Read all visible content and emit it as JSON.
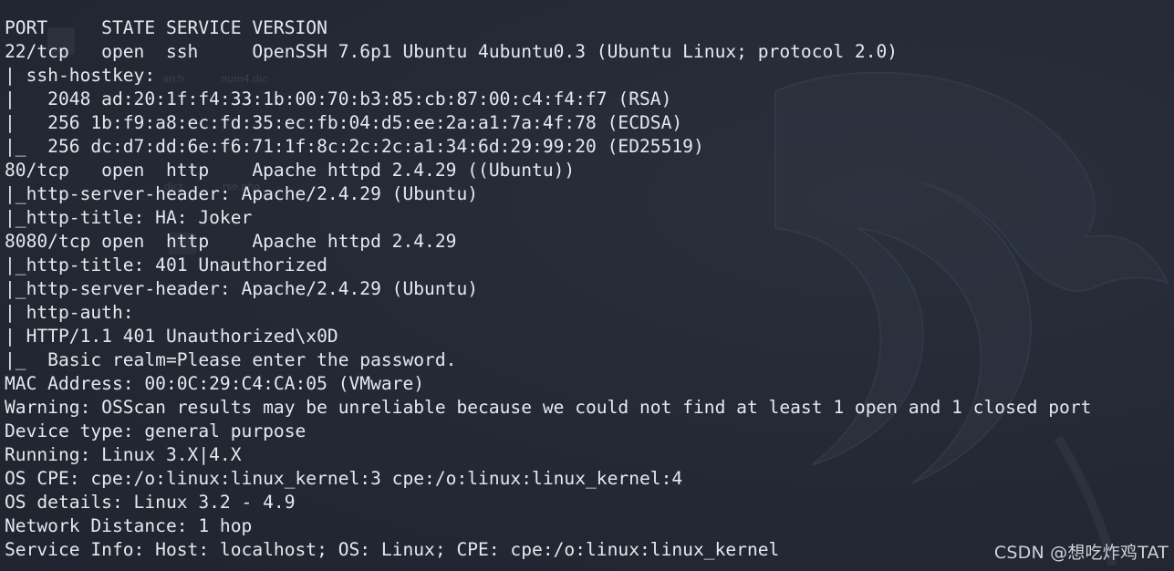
{
  "terminal": {
    "lines": [
      "PORT     STATE SERVICE VERSION",
      "22/tcp   open  ssh     OpenSSH 7.6p1 Ubuntu 4ubuntu0.3 (Ubuntu Linux; protocol 2.0)",
      "| ssh-hostkey: ",
      "|   2048 ad:20:1f:f4:33:1b:00:70:b3:85:cb:87:00:c4:f4:f7 (RSA)",
      "|   256 1b:f9:a8:ec:fd:35:ec:fb:04:d5:ee:2a:a1:7a:4f:78 (ECDSA)",
      "|_  256 dc:d7:dd:6e:f6:71:1f:8c:2c:2c:a1:34:6d:29:99:20 (ED25519)",
      "80/tcp   open  http    Apache httpd 2.4.29 ((Ubuntu))",
      "|_http-server-header: Apache/2.4.29 (Ubuntu)",
      "|_http-title: HA: Joker",
      "8080/tcp open  http    Apache httpd 2.4.29",
      "|_http-title: 401 Unauthorized",
      "|_http-server-header: Apache/2.4.29 (Ubuntu)",
      "| http-auth: ",
      "| HTTP/1.1 401 Unauthorized\\x0D",
      "|_  Basic realm=Please enter the password.",
      "MAC Address: 00:0C:29:C4:CA:05 (VMware)",
      "Warning: OSScan results may be unreliable because we could not find at least 1 open and 1 closed port",
      "Device type: general purpose",
      "Running: Linux 3.X|4.X",
      "OS CPE: cpe:/o:linux:linux_kernel:3 cpe:/o:linux:linux_kernel:4",
      "OS details: Linux 3.2 - 4.9",
      "Network Distance: 1 hop",
      "Service Info: Host: localhost; OS: Linux; CPE: cpe:/o:linux:linux_kernel"
    ]
  },
  "background": {
    "ghost_labels": [
      "arch",
      "num4.dic",
      "dict",
      "rse.pho"
    ]
  },
  "watermark": "CSDN @想吃炸鸡TAT",
  "colors": {
    "background": "#232733",
    "text": "#e6e8ee",
    "watermark": "#cfd2d8"
  }
}
